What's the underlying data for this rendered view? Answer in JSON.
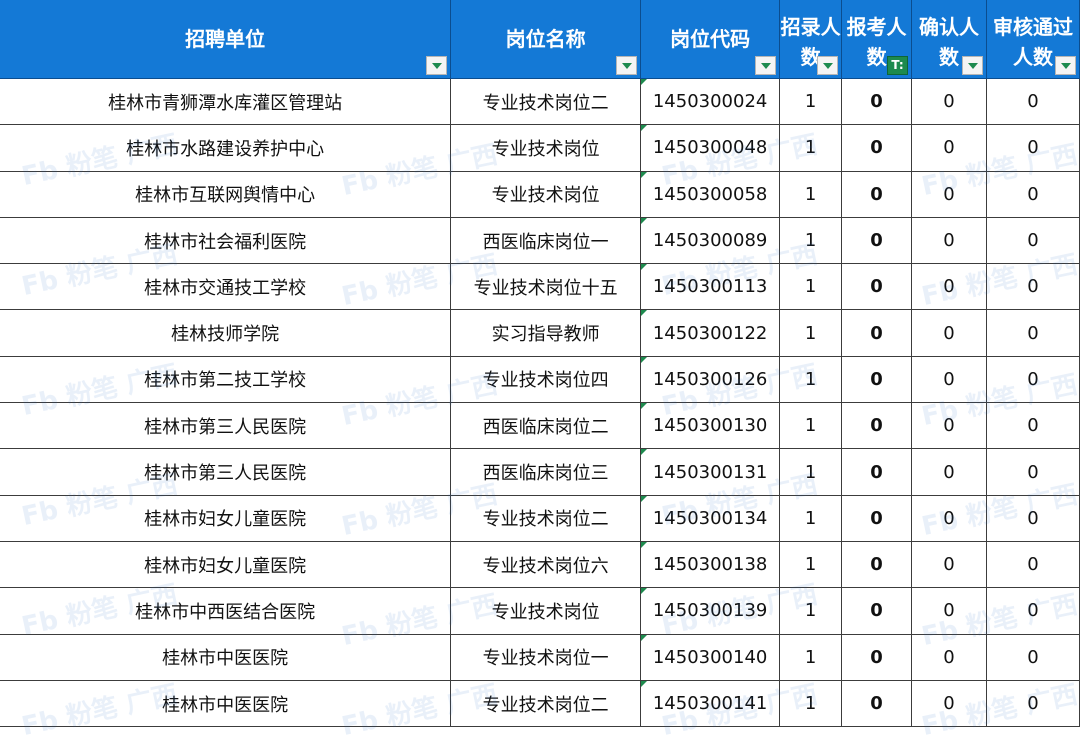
{
  "headers": [
    {
      "label": "招聘单位"
    },
    {
      "label": "岗位名称"
    },
    {
      "label": "岗位代码"
    },
    {
      "label": "招录人数"
    },
    {
      "label": "报考人数"
    },
    {
      "label": "确认人数"
    },
    {
      "label": "审核通过人数"
    }
  ],
  "filter_active_symbol": "T:",
  "rows": [
    {
      "unit": "桂林市青狮潭水库灌区管理站",
      "position": "专业技术岗位二",
      "code": "1450300024",
      "hire": "1",
      "apply": "0",
      "confirm": "0",
      "approved": "0"
    },
    {
      "unit": "桂林市水路建设养护中心",
      "position": "专业技术岗位",
      "code": "1450300048",
      "hire": "1",
      "apply": "0",
      "confirm": "0",
      "approved": "0"
    },
    {
      "unit": "桂林市互联网舆情中心",
      "position": "专业技术岗位",
      "code": "1450300058",
      "hire": "1",
      "apply": "0",
      "confirm": "0",
      "approved": "0"
    },
    {
      "unit": "桂林市社会福利医院",
      "position": "西医临床岗位一",
      "code": "1450300089",
      "hire": "1",
      "apply": "0",
      "confirm": "0",
      "approved": "0"
    },
    {
      "unit": "桂林市交通技工学校",
      "position": "专业技术岗位十五",
      "code": "1450300113",
      "hire": "1",
      "apply": "0",
      "confirm": "0",
      "approved": "0"
    },
    {
      "unit": "桂林技师学院",
      "position": "实习指导教师",
      "code": "1450300122",
      "hire": "1",
      "apply": "0",
      "confirm": "0",
      "approved": "0"
    },
    {
      "unit": "桂林市第二技工学校",
      "position": "专业技术岗位四",
      "code": "1450300126",
      "hire": "1",
      "apply": "0",
      "confirm": "0",
      "approved": "0"
    },
    {
      "unit": "桂林市第三人民医院",
      "position": "西医临床岗位二",
      "code": "1450300130",
      "hire": "1",
      "apply": "0",
      "confirm": "0",
      "approved": "0"
    },
    {
      "unit": "桂林市第三人民医院",
      "position": "西医临床岗位三",
      "code": "1450300131",
      "hire": "1",
      "apply": "0",
      "confirm": "0",
      "approved": "0"
    },
    {
      "unit": "桂林市妇女儿童医院",
      "position": "专业技术岗位二",
      "code": "1450300134",
      "hire": "1",
      "apply": "0",
      "confirm": "0",
      "approved": "0"
    },
    {
      "unit": "桂林市妇女儿童医院",
      "position": "专业技术岗位六",
      "code": "1450300138",
      "hire": "1",
      "apply": "0",
      "confirm": "0",
      "approved": "0"
    },
    {
      "unit": "桂林市中西医结合医院",
      "position": "专业技术岗位",
      "code": "1450300139",
      "hire": "1",
      "apply": "0",
      "confirm": "0",
      "approved": "0"
    },
    {
      "unit": "桂林市中医医院",
      "position": "专业技术岗位一",
      "code": "1450300140",
      "hire": "1",
      "apply": "0",
      "confirm": "0",
      "approved": "0"
    },
    {
      "unit": "桂林市中医医院",
      "position": "专业技术岗位二",
      "code": "1450300141",
      "hire": "1",
      "apply": "0",
      "confirm": "0",
      "approved": "0"
    }
  ],
  "watermark": "Fb 粉笔 广西",
  "colors": {
    "header_bg": "#1479D6",
    "header_text": "#ffffff",
    "filter_arrow": "#1d8a4e"
  }
}
